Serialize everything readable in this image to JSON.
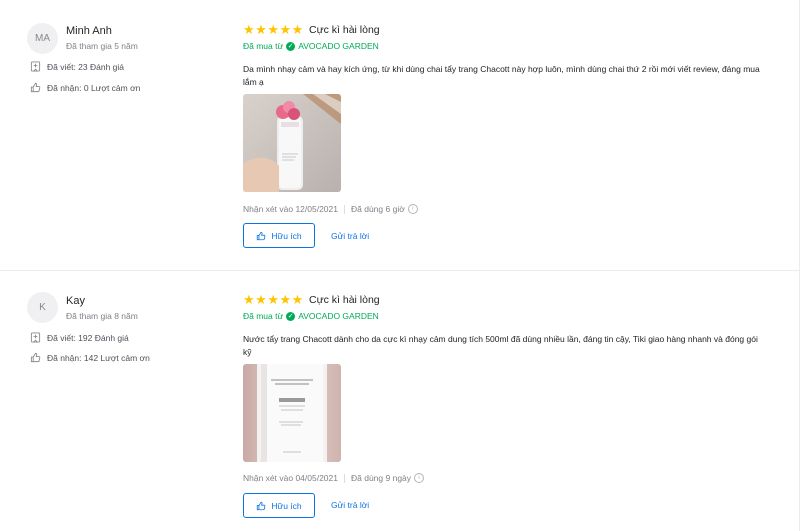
{
  "reviews": [
    {
      "initials": "MA",
      "name": "Minh Anh",
      "joined": "Đã tham gia 5 năm",
      "written": "Đã viết: 23 Đánh giá",
      "thanks": "Đã nhận: 0 Lượt cảm ơn",
      "stars": 5,
      "rating_title": "Cực kì hài lòng",
      "bought_prefix": "Đã mua từ",
      "seller": "AVOCADO GARDEN",
      "content": "Da mình nhạy cảm và hay kích ứng, từ khi dùng chai tẩy trang Chacott này hợp luôn, mình dùng chai thứ 2 rồi mới viết review, đáng mua lắm ạ",
      "reviewed_at": "Nhận xét vào 12/05/2021",
      "used_for": "Đã dùng 6 giờ",
      "helpful_label": "Hữu ích",
      "reply_label": "Gửi trả lời"
    },
    {
      "initials": "K",
      "name": "Kay",
      "joined": "Đã tham gia 8 năm",
      "written": "Đã viết: 192 Đánh giá",
      "thanks": "Đã nhận: 142 Lượt cảm ơn",
      "stars": 5,
      "rating_title": "Cực kì hài lòng",
      "bought_prefix": "Đã mua từ",
      "seller": "AVOCADO GARDEN",
      "content": "Nước tẩy trang Chacott dành cho da cực kì nhạy cảm dung tích 500ml đã dùng nhiều lần, đáng tin cậy, Tiki giao hàng nhanh và đóng gói kỹ",
      "reviewed_at": "Nhận xét vào 04/05/2021",
      "used_for": "Đã dùng 9 ngày",
      "helpful_label": "Hữu ích",
      "reply_label": "Gửi trả lời"
    }
  ],
  "icons": {
    "stat_written": "document-icon",
    "stat_thanks": "thumbs-up-icon",
    "verified": "check-circle-icon",
    "info": "info-icon"
  },
  "colors": {
    "star": "#ffc400",
    "verified": "#00ab56",
    "link": "#0b74e5"
  }
}
